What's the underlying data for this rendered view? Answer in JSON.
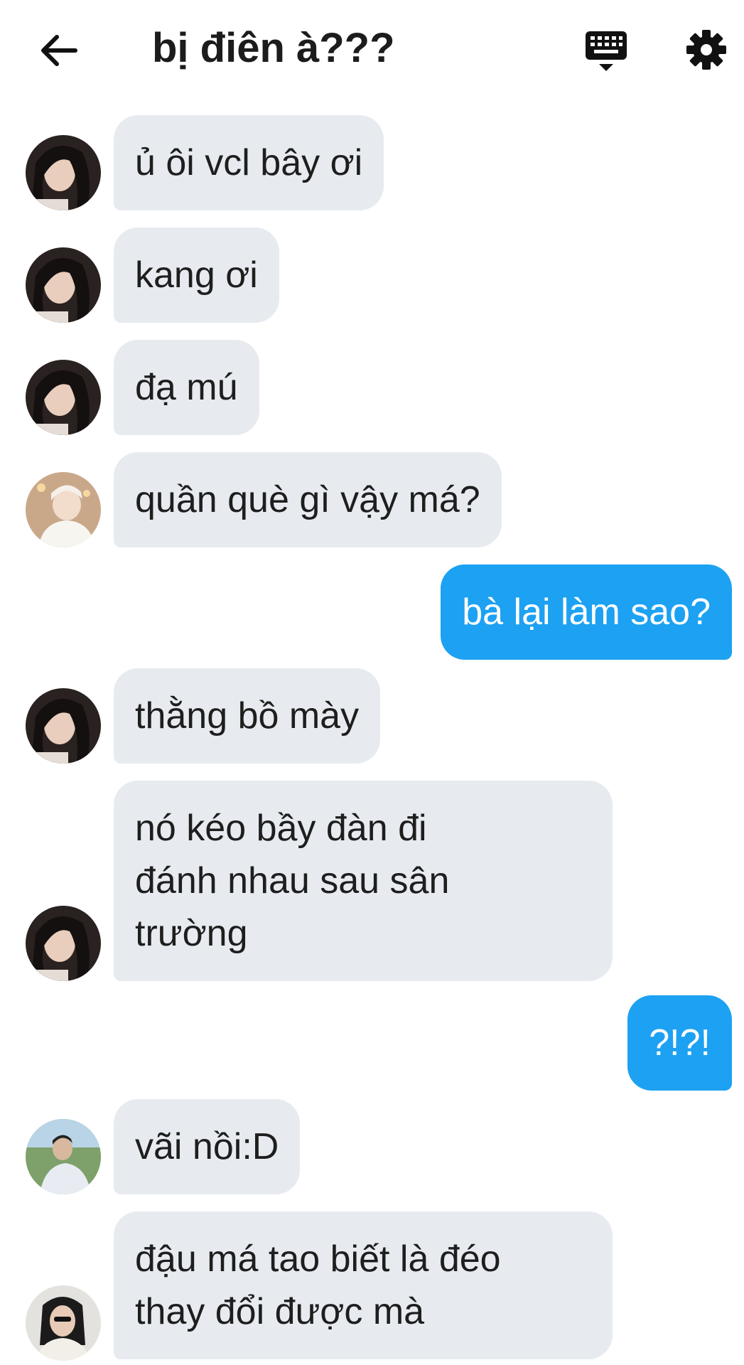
{
  "header": {
    "title": "bị điên à???",
    "back_icon": "arrow-left-icon",
    "keyboard_icon": "keyboard-icon",
    "settings_icon": "gear-icon"
  },
  "colors": {
    "incoming_bubble": "#e7ebf0",
    "outgoing_bubble": "#1da1f2"
  },
  "messages": [
    {
      "direction": "in",
      "text": "ủ ôi vcl bây ơi",
      "avatar": "user-a"
    },
    {
      "direction": "in",
      "text": "kang ơi",
      "avatar": "user-a"
    },
    {
      "direction": "in",
      "text": "đạ mú",
      "avatar": "user-a"
    },
    {
      "direction": "in",
      "text": "quần què gì vậy má?",
      "avatar": "user-b"
    },
    {
      "direction": "out",
      "text": "bà lại làm sao?"
    },
    {
      "direction": "in",
      "text": "thằng bồ mày",
      "avatar": "user-a"
    },
    {
      "direction": "in",
      "text": "nó kéo bầy đàn đi\nđánh nhau sau sân\ntrường",
      "avatar": "user-a"
    },
    {
      "direction": "out",
      "text": "?!?!"
    },
    {
      "direction": "in",
      "text": "vãi nồi:D",
      "avatar": "user-c"
    },
    {
      "direction": "in",
      "text": "đậu má tao biết là đéo\nthay đổi được mà",
      "avatar": "user-d"
    }
  ]
}
